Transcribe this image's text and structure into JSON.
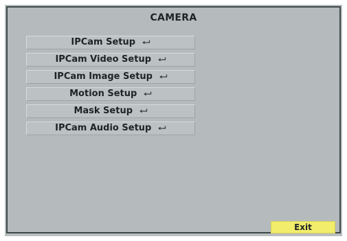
{
  "window": {
    "title": "CAMERA"
  },
  "menu": {
    "items": [
      {
        "label": "IPCam Setup",
        "icon": "enter-arrow-icon"
      },
      {
        "label": "IPCam Video Setup",
        "icon": "enter-arrow-icon"
      },
      {
        "label": "IPCam Image Setup",
        "icon": "enter-arrow-icon"
      },
      {
        "label": "Motion Setup",
        "icon": "enter-arrow-icon"
      },
      {
        "label": "Mask Setup",
        "icon": "enter-arrow-icon"
      },
      {
        "label": "IPCam Audio Setup",
        "icon": "enter-arrow-icon"
      }
    ]
  },
  "footer": {
    "exit_label": "Exit"
  },
  "colors": {
    "background": "#b9bfbf",
    "panel_border": "#3e4648",
    "exit_button": "#f2ed6a",
    "text": "#1e2325"
  }
}
